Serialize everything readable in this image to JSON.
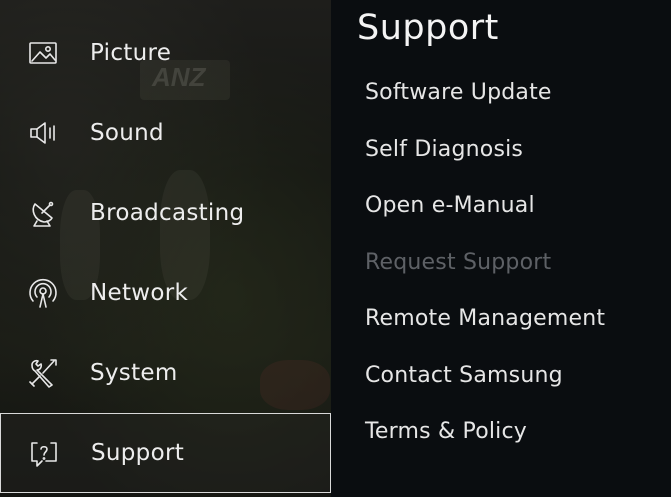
{
  "menu": {
    "items": [
      {
        "label": "Picture",
        "icon": "picture-icon"
      },
      {
        "label": "Sound",
        "icon": "speaker-icon"
      },
      {
        "label": "Broadcasting",
        "icon": "satellite-dish-icon"
      },
      {
        "label": "Network",
        "icon": "network-signal-icon"
      },
      {
        "label": "System",
        "icon": "tools-icon"
      },
      {
        "label": "Support",
        "icon": "help-bubble-icon",
        "selected": true
      }
    ]
  },
  "submenu": {
    "title": "Support",
    "items": [
      {
        "label": "Software Update",
        "enabled": true
      },
      {
        "label": "Self Diagnosis",
        "enabled": true
      },
      {
        "label": "Open e-Manual",
        "enabled": true
      },
      {
        "label": "Request Support",
        "enabled": false
      },
      {
        "label": "Remote Management",
        "enabled": true
      },
      {
        "label": "Contact Samsung",
        "enabled": true
      },
      {
        "label": "Terms & Policy",
        "enabled": true
      }
    ]
  },
  "background_text": "ANZ",
  "colors": {
    "submenu_background": "#0a0d10",
    "text_primary": "#ededed",
    "text_disabled": "#5e6166",
    "selection_border": "#d9d9d9"
  }
}
